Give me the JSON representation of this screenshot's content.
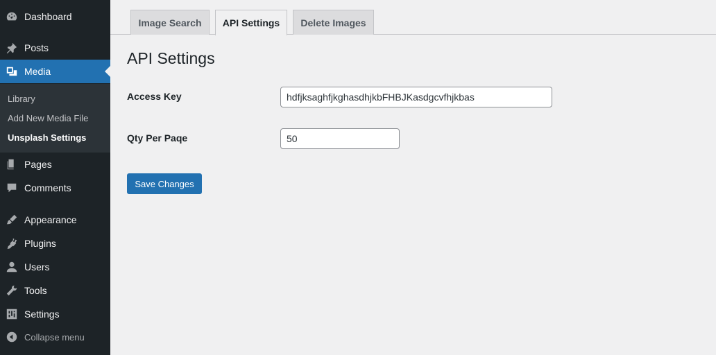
{
  "sidebar": {
    "items": [
      {
        "label": "Dashboard",
        "icon": "dashboard-icon"
      },
      {
        "label": "Posts",
        "icon": "pin-icon"
      },
      {
        "label": "Media",
        "icon": "media-icon"
      },
      {
        "label": "Pages",
        "icon": "pages-icon"
      },
      {
        "label": "Comments",
        "icon": "comment-icon"
      },
      {
        "label": "Appearance",
        "icon": "brush-icon"
      },
      {
        "label": "Plugins",
        "icon": "plug-icon"
      },
      {
        "label": "Users",
        "icon": "user-icon"
      },
      {
        "label": "Tools",
        "icon": "wrench-icon"
      },
      {
        "label": "Settings",
        "icon": "sliders-icon"
      }
    ],
    "submenu": [
      "Library",
      "Add New Media File",
      "Unsplash Settings"
    ],
    "collapse_label": "Collapse menu"
  },
  "tabs": [
    "Image Search",
    "API Settings",
    "Delete Images"
  ],
  "page_title": "API Settings",
  "form": {
    "access_key_label": "Access Key",
    "access_key_value": "hdfjksaghfjkghasdhjkbFHBJKasdgcvfhjkbas",
    "qty_label": "Qty Per Paqe",
    "qty_value": "50",
    "save_label": "Save Changes"
  },
  "colors": {
    "sidebar_bg": "#1d2327",
    "accent": "#2271b1",
    "submenu_bg": "#2c3338"
  }
}
